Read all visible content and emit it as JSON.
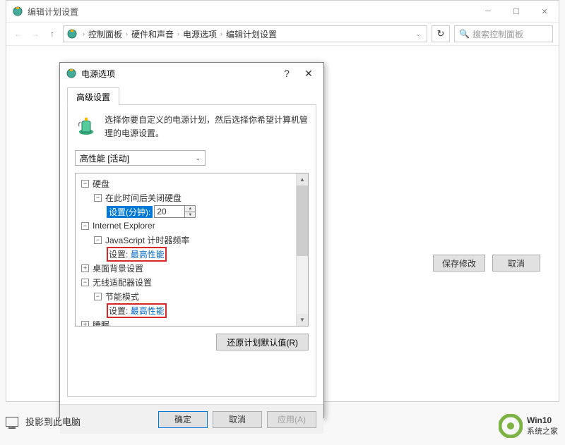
{
  "cp": {
    "title": "编辑计划设置",
    "breadcrumb": [
      "控制面板",
      "硬件和声音",
      "电源选项",
      "编辑计划设置"
    ],
    "search_placeholder": "搜索控制面板",
    "save_btn": "保存修改",
    "cancel_btn": "取消"
  },
  "dlg": {
    "title": "电源选项",
    "tab": "高级设置",
    "description": "选择你要自定义的电源计划，然后选择你希望计算机管理的电源设置。",
    "plan_selected": "高性能 [活动]",
    "tree": {
      "hard_disk": "硬盘",
      "hd_turnoff": "在此时间后关闭硬盘",
      "setting_minutes": "设置(分钟):",
      "minutes_value": "20",
      "ie": "Internet Explorer",
      "js_timer": "JavaScript 计时器频率",
      "setting_label": "设置:",
      "max_perf": "最高性能",
      "desktop_bg": "桌面背景设置",
      "wireless": "无线适配器设置",
      "power_save_mode": "节能模式",
      "sleep": "睡眠"
    },
    "restore_defaults": "还原计划默认值(R)",
    "ok": "确定",
    "cancel": "取消",
    "apply": "应用(A)"
  },
  "taskbar": {
    "project": "投影到此电脑"
  },
  "watermark": {
    "line1": "Win10",
    "line2": "系统之家"
  }
}
